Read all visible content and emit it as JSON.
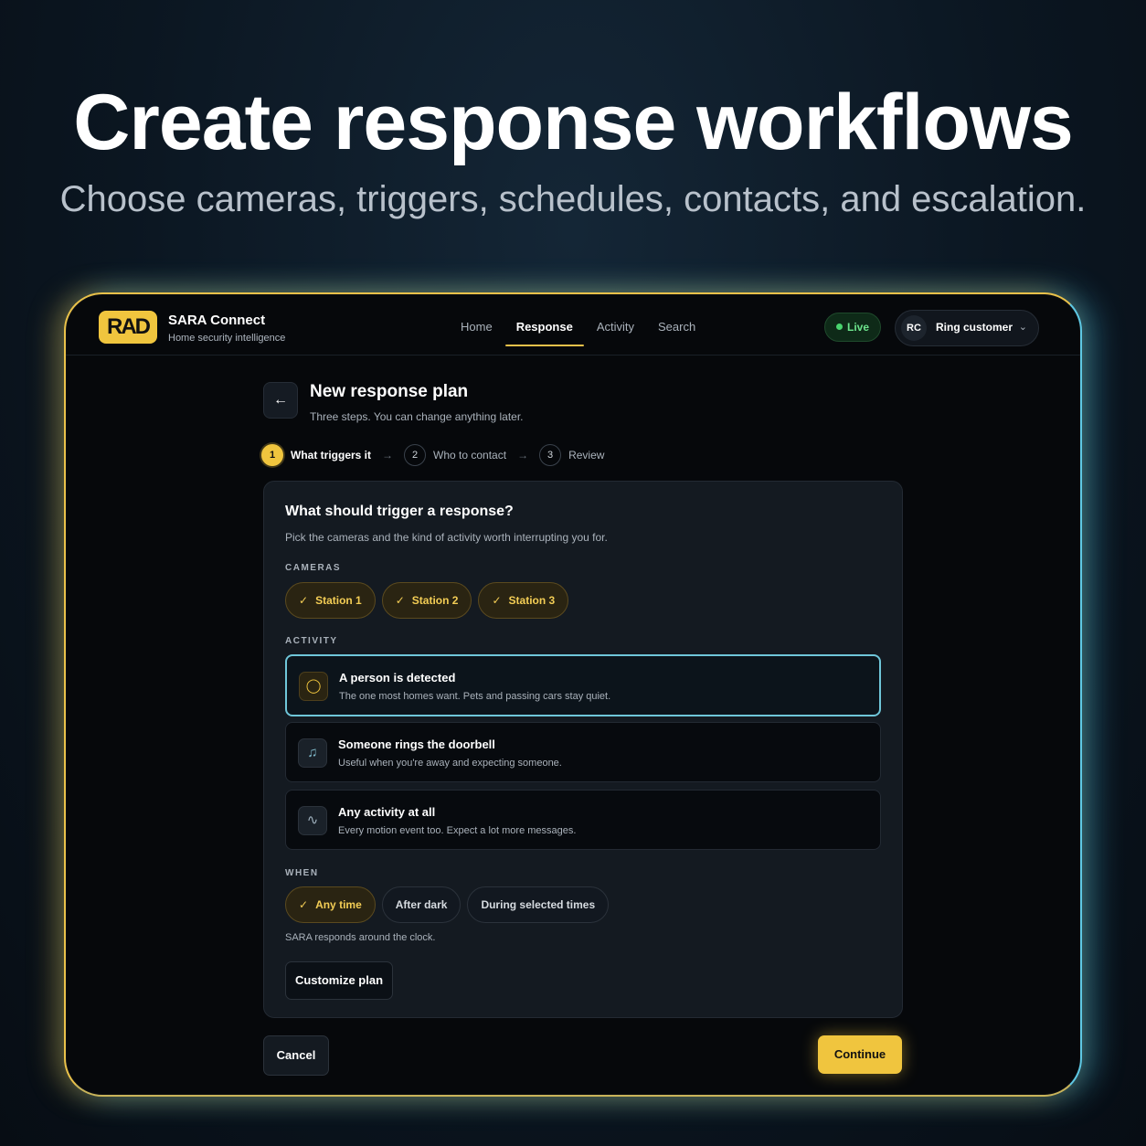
{
  "hero": {
    "title": "Create response workflows",
    "subtitle": "Choose cameras, triggers, schedules, contacts, and escalation."
  },
  "brand": {
    "logo_text": "RAD",
    "name": "SARA Connect",
    "tagline": "Home security intelligence",
    "accent": "#f0c53e"
  },
  "nav": {
    "items": [
      {
        "label": "Home",
        "active": false
      },
      {
        "label": "Response",
        "active": true
      },
      {
        "label": "Activity",
        "active": false
      },
      {
        "label": "Search",
        "active": false
      }
    ]
  },
  "status": {
    "live_label": "Live",
    "live_color": "#49d36e"
  },
  "user": {
    "initials": "RC",
    "name": "Ring customer",
    "dropdown_icon": "chevron-down-icon"
  },
  "page": {
    "back_icon": "arrow-left-icon",
    "title": "New response plan",
    "subtitle": "Three steps. You can change anything later."
  },
  "steps": [
    {
      "number": "1",
      "label": "What triggers it",
      "active": true
    },
    {
      "number": "2",
      "label": "Who to contact",
      "active": false
    },
    {
      "number": "3",
      "label": "Review",
      "active": false
    }
  ],
  "trigger_card": {
    "title": "What should trigger a response?",
    "subtitle": "Pick the cameras and the kind of activity worth interrupting you for.",
    "cameras_label": "CAMERAS",
    "cameras": [
      {
        "label": "Station 1",
        "selected": true
      },
      {
        "label": "Station 2",
        "selected": true
      },
      {
        "label": "Station 3",
        "selected": true
      }
    ],
    "activity_label": "ACTIVITY",
    "activities": [
      {
        "icon": "person-icon",
        "title": "A person is detected",
        "description": "The one most homes want. Pets and passing cars stay quiet.",
        "selected": true
      },
      {
        "icon": "bell-icon",
        "title": "Someone rings the doorbell",
        "description": "Useful when you're away and expecting someone.",
        "selected": false
      },
      {
        "icon": "activity-pulse-icon",
        "title": "Any activity at all",
        "description": "Every motion event too. Expect a lot more messages.",
        "selected": false
      }
    ],
    "when_label": "WHEN",
    "when_options": [
      {
        "label": "Any time",
        "selected": true
      },
      {
        "label": "After dark",
        "selected": false
      },
      {
        "label": "During selected times",
        "selected": false
      }
    ],
    "when_note": "SARA responds around the clock.",
    "customize_label": "Customize plan"
  },
  "footer": {
    "cancel_label": "Cancel",
    "continue_label": "Continue"
  }
}
